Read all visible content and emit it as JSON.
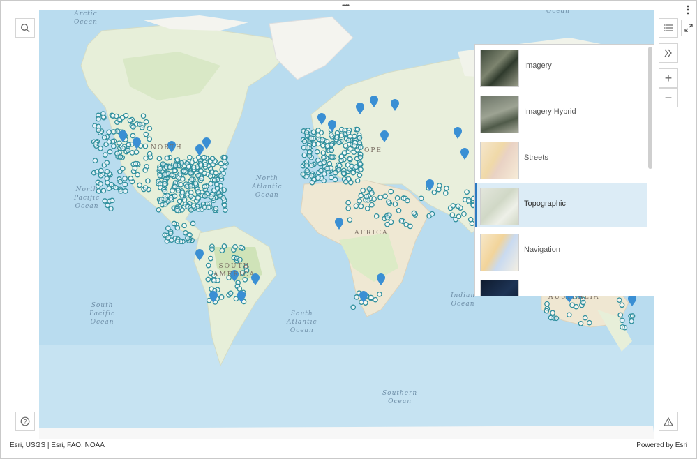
{
  "map": {
    "ocean_labels": [
      {
        "text": "Arctic\nOcean"
      },
      {
        "text": "Ocean"
      },
      {
        "text": "North\nPacific\nOcean"
      },
      {
        "text": "North\nAtlantic\nOcean"
      },
      {
        "text": "South\nPacific\nOcean"
      },
      {
        "text": "South\nAtlantic\nOcean"
      },
      {
        "text": "Indian\nOcean"
      },
      {
        "text": "Southern\nOcean"
      }
    ],
    "land_labels": [
      {
        "text": "NORTH"
      },
      {
        "text": "OPE"
      },
      {
        "text": "AFRICA"
      },
      {
        "text": "SOUTH\nAMERICA"
      },
      {
        "text": "AUSTRALIA"
      }
    ],
    "marker_color": "#2f8f9d",
    "pin_color": "#3a8fd4"
  },
  "basemap_gallery": {
    "items": [
      {
        "label": "Imagery",
        "selected": false
      },
      {
        "label": "Imagery Hybrid",
        "selected": false
      },
      {
        "label": "Streets",
        "selected": false
      },
      {
        "label": "Topographic",
        "selected": true
      },
      {
        "label": "Navigation",
        "selected": false
      },
      {
        "label": "",
        "selected": false
      }
    ]
  },
  "controls": {
    "search_icon": "search-icon",
    "legend_icon": "list-icon",
    "collapse_icon": "double-chevron-right-icon",
    "zoom_in": "+",
    "zoom_out": "−",
    "help_icon": "question-icon",
    "warning_icon": "warning-icon",
    "menu_icon": "more-vertical-icon",
    "expand_icon": "expand-icon"
  },
  "attribution": {
    "left": "Esri, USGS | Esri, FAO, NOAA",
    "right": "Powered by Esri"
  }
}
